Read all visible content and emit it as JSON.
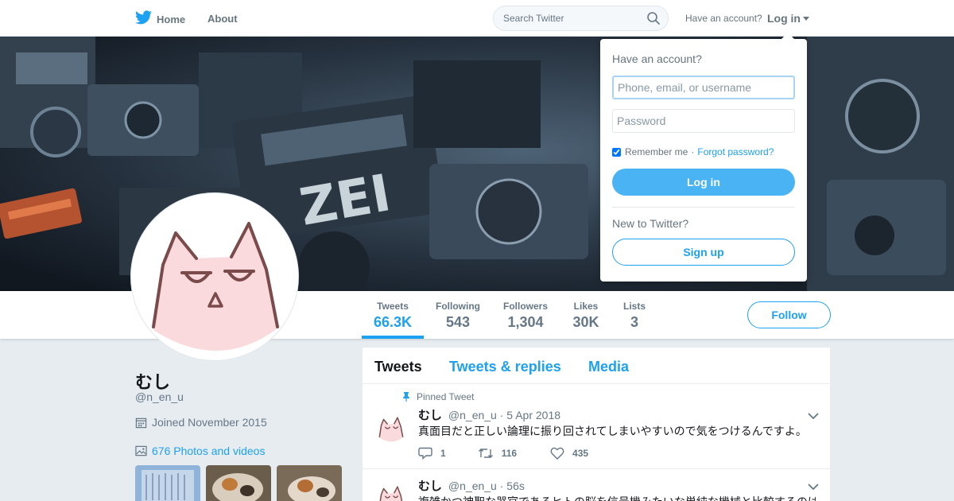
{
  "topnav": {
    "home_label": "Home",
    "about_label": "About",
    "search_placeholder": "Search Twitter",
    "have_account": "Have an account?",
    "login_label": "Log in"
  },
  "profile_nav": {
    "stats": [
      {
        "label": "Tweets",
        "value": "66.3K"
      },
      {
        "label": "Following",
        "value": "543"
      },
      {
        "label": "Followers",
        "value": "1,304"
      },
      {
        "label": "Likes",
        "value": "30K"
      },
      {
        "label": "Lists",
        "value": "3"
      }
    ],
    "follow_label": "Follow"
  },
  "profile": {
    "name": "むし",
    "handle": "@n_en_u",
    "joined": "Joined November 2015",
    "photos": "676 Photos and videos"
  },
  "timeline": {
    "tabs": [
      "Tweets",
      "Tweets & replies",
      "Media"
    ],
    "tweets": [
      {
        "pinned_label": "Pinned Tweet",
        "name": "むし",
        "handle": "@n_en_u",
        "time": "5 Apr 2018",
        "text": "真面目だと正しい論理に振り回されてしまいやすいので気をつけるんですよ。",
        "replies": "1",
        "retweets": "116",
        "likes": "435"
      },
      {
        "name": "むし",
        "handle": "@n_en_u",
        "time": "56s",
        "text": "複雑かつ神聖な器官であるヒトの脳を信号機みたいな単純な機械と比較するのは"
      }
    ]
  },
  "login_dropdown": {
    "title": "Have an account?",
    "username_placeholder": "Phone, email, or username",
    "password_placeholder": "Password",
    "remember_label": "Remember me",
    "separator": "·",
    "forgot_label": "Forgot password?",
    "login_button": "Log in",
    "new_label": "New to Twitter?",
    "signup_button": "Sign up"
  },
  "colors": {
    "accent": "#1da1f2",
    "login_button": "#4ab3f4",
    "background": "#e6ecf0"
  }
}
